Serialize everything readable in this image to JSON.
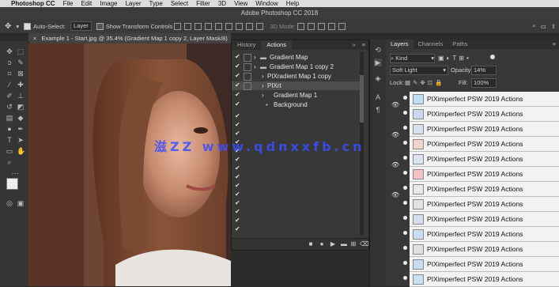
{
  "menubar": {
    "app": "Photoshop CC",
    "items": [
      "File",
      "Edit",
      "Image",
      "Layer",
      "Type",
      "Select",
      "Filter",
      "3D",
      "View",
      "Window",
      "Help"
    ]
  },
  "window": {
    "title": "Adobe Photoshop CC 2018"
  },
  "options": {
    "auto_select_label": "Auto-Select:",
    "auto_select_value": "Layer",
    "transform_label": "Show Transform Controls",
    "mode_label": "3D Mode:"
  },
  "doc_tab": {
    "label": "Example 1 - Start.jpg @ 35.4% (Gradient Map 1 copy 2, Layer Mask/8)"
  },
  "history_panel": {
    "tabs": [
      "History",
      "Actions"
    ],
    "actions": [
      {
        "label": "Gradient Map",
        "type": "set"
      },
      {
        "label": "Gradient Map 1 copy 2",
        "type": "set"
      },
      {
        "label": "PIXradient Map 1 copy",
        "type": "action"
      },
      {
        "label": "PIXrt",
        "type": "action"
      },
      {
        "label": "Gradient Map 1",
        "type": "action"
      },
      {
        "label": "Background",
        "type": "item"
      }
    ]
  },
  "layers_panel": {
    "tabs": [
      "Layers",
      "Channels",
      "Paths"
    ],
    "kind_label": "Kind",
    "blend_mode": "Soft Light",
    "opacity_label": "Opacity:",
    "opacity_value": "14%",
    "lock_label": "Lock:",
    "fill_label": "Fill:",
    "fill_value": "100%",
    "rows": [
      {
        "name": "PIXimperfect PSW 2019 Actions",
        "thumb": "#bfe0f2"
      },
      {
        "name": "PIXimperfect PSW 2019 Actions",
        "thumb": "#cfd7ee"
      },
      {
        "name": "PIXimperfect PSW 2019 Actions",
        "thumb": "#d3e1f0"
      },
      {
        "name": "PIXimperfect PSW 2019 Actions",
        "thumb": "#f0d4cb"
      },
      {
        "name": "PIXimperfect PSW 2019 Actions",
        "thumb": "#dbe4ee"
      },
      {
        "name": "PIXimperfect PSW 2019 Actions",
        "thumb": "#f2c3c0"
      },
      {
        "name": "PIXimperfect PSW 2019 Actions",
        "thumb": "#e8e8e8"
      },
      {
        "name": "PIXimperfect PSW 2019 Actions",
        "thumb": "#e2e2e2"
      },
      {
        "name": "PIXimperfect PSW 2019 Actions",
        "thumb": "#d8ddee"
      },
      {
        "name": "PIXimperfect PSW 2019 Actions",
        "thumb": "#c9def0"
      },
      {
        "name": "PIXimperfect PSW 2019 Actions",
        "thumb": "#e0e0e0"
      },
      {
        "name": "PIXimperfect PSW 2019 Actions",
        "thumb": "#cadcf0"
      },
      {
        "name": "PIXimperfect PSW 2019 Actions",
        "thumb": "#c8e4f2"
      }
    ]
  },
  "watermark": {
    "text": "滋ZZ www.qdnxxfb.cn"
  }
}
